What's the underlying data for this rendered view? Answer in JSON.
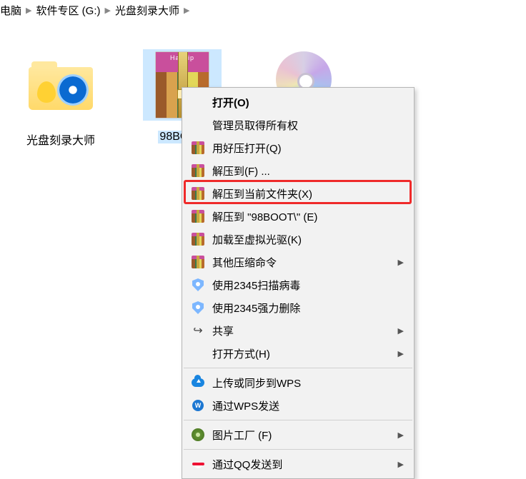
{
  "breadcrumb": {
    "p0": "电脑",
    "p1": "软件专区 (G:)",
    "p2": "光盘刻录大师"
  },
  "files": {
    "folder_label": "光盘刻录大师",
    "rar_label": "98BOOT",
    "disc_label": ""
  },
  "rar_top_text": "Haozip",
  "menu": {
    "open": "打开(O)",
    "admin": "管理员取得所有权",
    "open_haozip": "用好压打开(Q)",
    "extract_to": "解压到(F) ...",
    "extract_here": "解压到当前文件夹(X)",
    "extract_named": "解压到 \"98BOOT\\\" (E)",
    "mount": "加载至虚拟光驱(K)",
    "other_compress": "其他压缩命令",
    "scan_2345": "使用2345扫描病毒",
    "del_2345": "使用2345强力删除",
    "share": "共享",
    "open_with": "打开方式(H)",
    "upload_wps": "上传或同步到WPS",
    "send_wps": "通过WPS发送",
    "pic_factory": "图片工厂 (F)",
    "send_qq": "通过QQ发送到"
  }
}
